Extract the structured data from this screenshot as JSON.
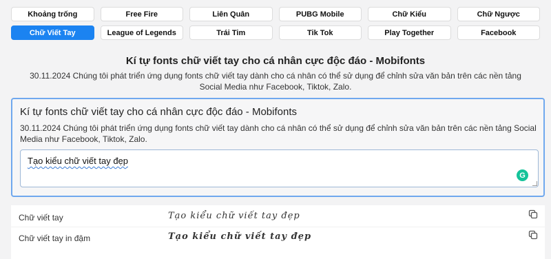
{
  "tabs": [
    {
      "label": "Khoảng trống",
      "active": false
    },
    {
      "label": "Free Fire",
      "active": false
    },
    {
      "label": "Liên Quân",
      "active": false
    },
    {
      "label": "PUBG Mobile",
      "active": false
    },
    {
      "label": "Chữ Kiểu",
      "active": false
    },
    {
      "label": "Chữ Ngược",
      "active": false
    },
    {
      "label": "Chữ Viết Tay",
      "active": true
    },
    {
      "label": "League of Legends",
      "active": false
    },
    {
      "label": "Trái Tim",
      "active": false
    },
    {
      "label": "Tik Tok",
      "active": false
    },
    {
      "label": "Play Together",
      "active": false
    },
    {
      "label": "Facebook",
      "active": false
    }
  ],
  "header": {
    "title": "Kí tự fonts chữ viết tay cho cá nhân cực độc đáo - Mobifonts",
    "description": "30.11.2024 Chúng tôi phát triển ứng dụng fonts chữ viết tay dành cho cá nhân có thể sử dụng để chỉnh sửa văn bản trên các nền tảng Social Media như Facebook, Tiktok, Zalo."
  },
  "card": {
    "title": "Kí tự fonts chữ viết tay cho cá nhân cực độc đáo - Mobifonts",
    "description": "30.11.2024 Chúng tôi phát triển ứng dụng fonts chữ viết tay dành cho cá nhân có thể sử dụng để chỉnh sửa văn bản trên các nền tảng Social Media như Facebook, Tiktok, Zalo.",
    "input_value": "Tạo kiểu chữ viết tay đẹp",
    "grammar_icon_letter": "G"
  },
  "results": [
    {
      "label": "Chữ viết tay",
      "value": "Tạo kiểu chữ viết tay đẹp",
      "style": "italic"
    },
    {
      "label": "Chữ viết tay in đậm",
      "value": "Tạo kiểu chữ viết tay đẹp",
      "style": "bold-italic"
    }
  ],
  "icons": {
    "copy": "copy-icon",
    "grammar": "grammarly-icon"
  },
  "colors": {
    "accent": "#1b83f1",
    "card_border": "#6fa8ee",
    "grammarly": "#15c39a"
  }
}
